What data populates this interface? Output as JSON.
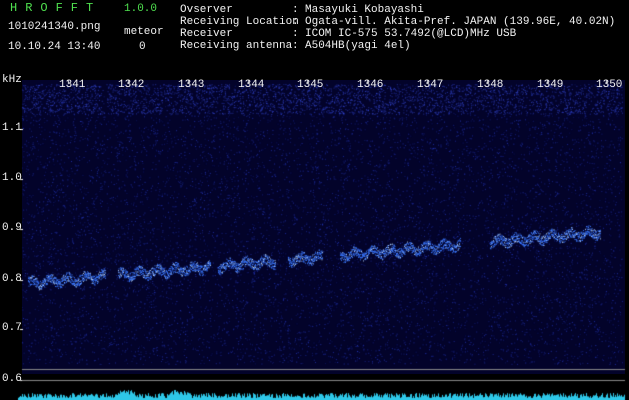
{
  "header": {
    "app_title": "HROFFT",
    "version": "1.0.0",
    "file_name": "1010241340.png",
    "datetime": "10.10.24 13:40",
    "meteor_label": "meteor",
    "meteor_count": "0"
  },
  "info": [
    {
      "label": "Ovserver",
      "value": "Masayuki Kobayashi"
    },
    {
      "label": "Receiving Location",
      "value": "Ogata-vill. Akita-Pref. JAPAN (139.96E, 40.02N)"
    },
    {
      "label": "Receiver",
      "value": "ICOM IC-575 53.7492(@LCD)MHz USB"
    },
    {
      "label": "Receiving antenna",
      "value": "A504HB(yagi 4el)"
    }
  ],
  "info_separator": ":",
  "plot": {
    "y_unit": "kHz",
    "x_ticks": [
      "1341",
      "1342",
      "1343",
      "1344",
      "1345",
      "1346",
      "1347",
      "1348",
      "1349",
      "1350"
    ],
    "y_ticks": [
      "1.1",
      "1.0",
      "0.9",
      "0.8",
      "0.7",
      "0.6"
    ],
    "colors": {
      "background": "#03032a",
      "signal": "#3a78ff",
      "signal_bright": "#b8d8ff",
      "bottom_band": "#2ec8e8",
      "reference_line": "#8a8a8a"
    }
  }
}
